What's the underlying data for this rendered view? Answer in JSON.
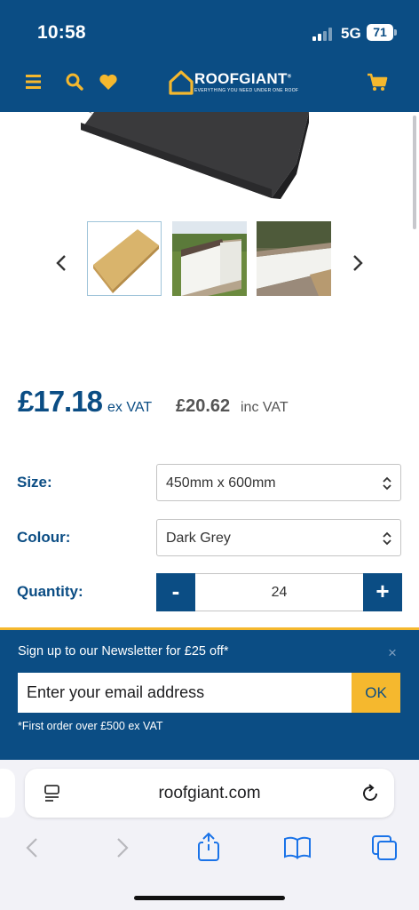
{
  "status_bar": {
    "time": "10:58",
    "network": "5G",
    "battery": "71"
  },
  "header": {
    "logo_text": "ROOFGIANT",
    "logo_registered": "®",
    "logo_tagline": "EVERYTHING YOU NEED UNDER ONE ROOF",
    "icons": [
      "menu-icon",
      "search-icon",
      "heart-icon",
      "cart-icon"
    ],
    "brand_color": "#0b4d84",
    "accent_color": "#f5b82e"
  },
  "gallery": {
    "thumbnails": [
      "coping-stone-buff",
      "wall-coping-garden",
      "white-wall-coping"
    ],
    "selected_index": 0
  },
  "price": {
    "ex_vat": "£17.18",
    "ex_vat_label": "ex VAT",
    "inc_vat": "£20.62",
    "inc_vat_label": "inc VAT"
  },
  "options": {
    "size": {
      "label": "Size:",
      "value": "450mm x 600mm"
    },
    "colour": {
      "label": "Colour:",
      "value": "Dark Grey"
    },
    "quantity": {
      "label": "Quantity:",
      "value": "24",
      "minus": "-",
      "plus": "+"
    }
  },
  "newsletter": {
    "title": "Sign up to our Newsletter for £25 off*",
    "close": "×",
    "placeholder": "Enter your email address",
    "button": "OK",
    "note": "*First order over £500 ex VAT"
  },
  "browser": {
    "url": "roofgiant.com"
  }
}
